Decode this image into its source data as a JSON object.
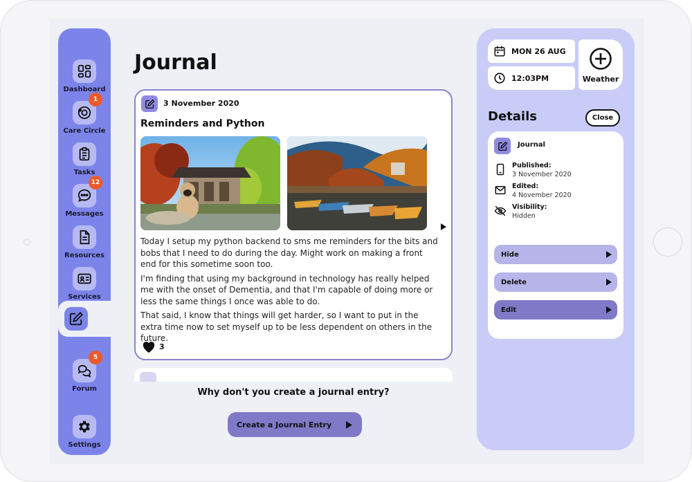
{
  "sidebar": {
    "items": [
      {
        "label": "Dashboard",
        "icon": "dashboard-icon"
      },
      {
        "label": "Care Circle",
        "icon": "care-circle-icon",
        "badge": "1"
      },
      {
        "label": "Tasks",
        "icon": "clipboard-icon"
      },
      {
        "label": "Messages",
        "icon": "chat-icon",
        "badge": "12"
      },
      {
        "label": "Resources",
        "icon": "document-icon"
      },
      {
        "label": "Services",
        "icon": "id-card-icon"
      },
      {
        "label": "",
        "icon": "journal-edit-icon",
        "active": true
      },
      {
        "label": "Forum",
        "icon": "forum-icon",
        "badge": "5"
      },
      {
        "label": "Settings",
        "icon": "gear-icon"
      }
    ]
  },
  "main": {
    "title": "Journal",
    "entry": {
      "date": "3 November 2020",
      "heading": "Reminders and Python",
      "paragraphs": [
        "Today I setup my python backend to sms me reminders for the bits and bobs that I need to do during the day. Might work on making a front end for this sometime soon too.",
        "I'm finding that using my background in technology has really helped me with the onset of Dementia, and that I'm capable of doing more or less the same things I once was able to do.",
        "That said, I know that things will get harder, so I want to put in the extra time now to set myself up to be less dependent on others in the future."
      ],
      "likes": "3"
    },
    "prompt": "Why don't you create a journal entry?",
    "create_button": "Create a Journal Entry"
  },
  "right_panel": {
    "date": "MON 26 AUG",
    "time": "12:03PM",
    "weather_label": "Weather",
    "details_title": "Details",
    "close_label": "Close",
    "card": {
      "title": "Journal",
      "published_label": "Published:",
      "published_value": "3 November 2020",
      "edited_label": "Edited:",
      "edited_value": "4 November 2020",
      "visibility_label": "Visibility:",
      "visibility_value": "Hidden"
    },
    "buttons": {
      "hide": "Hide",
      "delete": "Delete",
      "edit": "Edit"
    }
  },
  "colors": {
    "sidebar": "#7c84ea",
    "accent": "#7f79c7",
    "light_accent": "#b7b4e9",
    "panel": "#c8ccf6",
    "badge": "#ec5a2a"
  }
}
